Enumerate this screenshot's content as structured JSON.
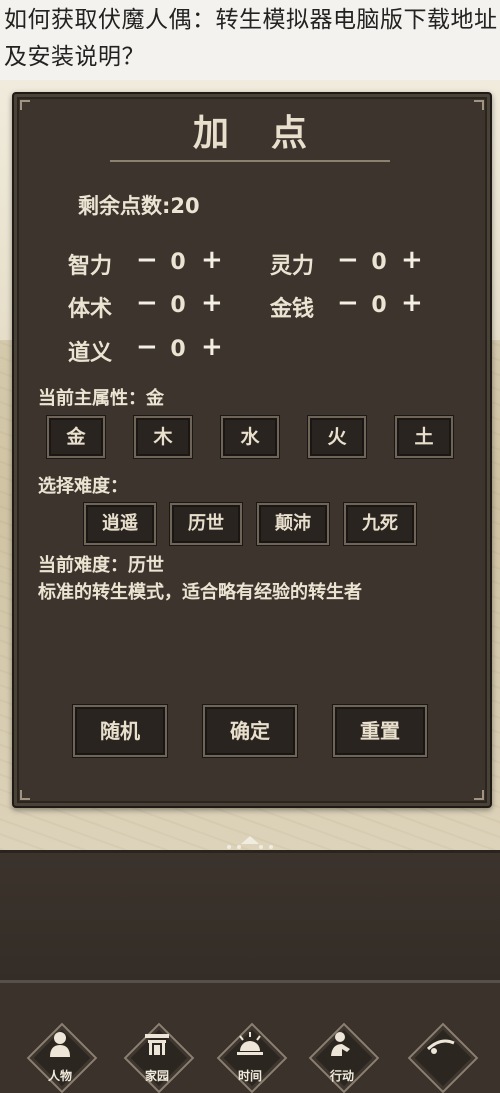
{
  "caption": "如何获取伏魔人偶：转生模拟器电脑版下载地址及安装说明？",
  "dialog": {
    "title": "加点",
    "remaining": "剩余点数:20",
    "stats": [
      {
        "label": "智力",
        "value": "0"
      },
      {
        "label": "灵力",
        "value": "0"
      },
      {
        "label": "体术",
        "value": "0"
      },
      {
        "label": "金钱",
        "value": "0"
      },
      {
        "label": "道义",
        "value": "0"
      }
    ],
    "minus": "−",
    "plus": "+",
    "current_attr": "当前主属性：金",
    "elements": [
      "金",
      "木",
      "水",
      "火",
      "土"
    ],
    "choose_difficulty": "选择难度：",
    "difficulties": [
      "逍遥",
      "历世",
      "颠沛",
      "九死"
    ],
    "current_difficulty": "当前难度：历世",
    "difficulty_desc": "标准的转生模式，适合略有经验的转生者",
    "actions": {
      "random": "随机",
      "confirm": "确定",
      "reset": "重置"
    }
  },
  "nav": [
    {
      "label": "人物",
      "icon": "person-icon"
    },
    {
      "label": "家园",
      "icon": "house-icon"
    },
    {
      "label": "时间",
      "icon": "sun-icon"
    },
    {
      "label": "行动",
      "icon": "action-icon"
    },
    {
      "label": "",
      "icon": "more-icon"
    }
  ],
  "colors": {
    "panel": "#3d352d",
    "text": "#ece4d3",
    "border": "#6e6457"
  }
}
